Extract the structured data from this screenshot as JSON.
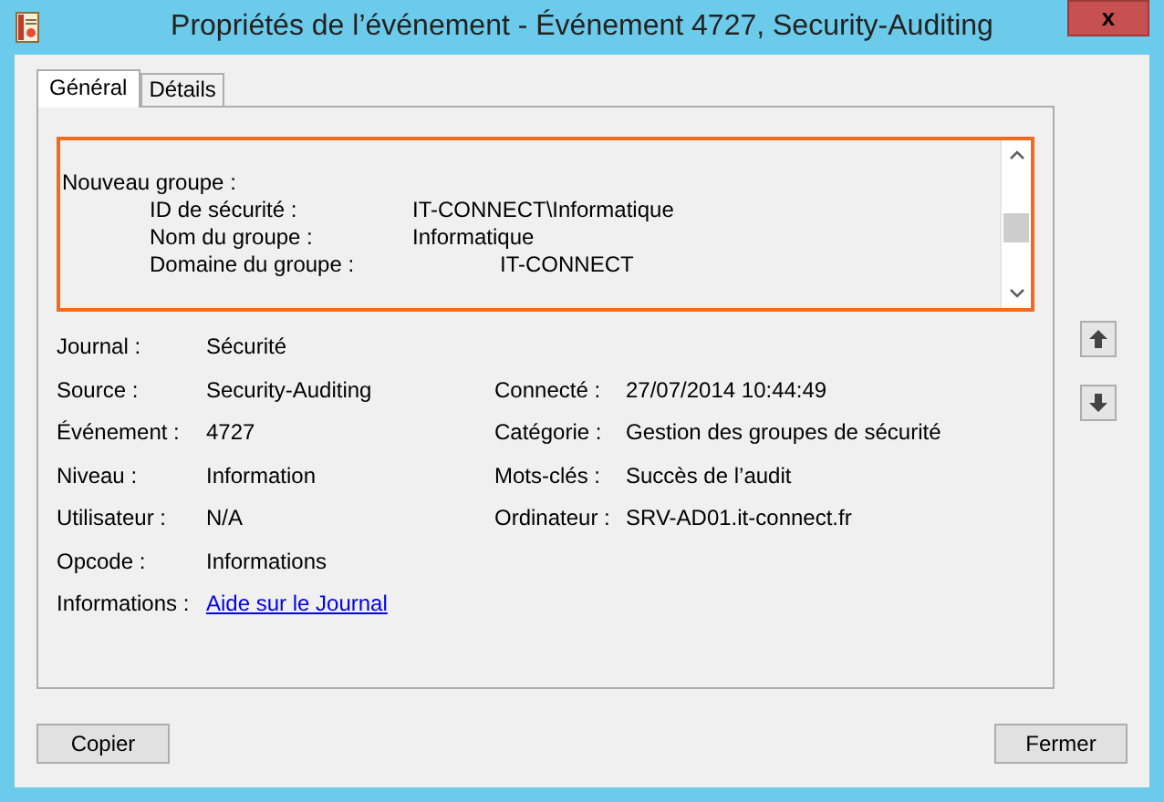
{
  "window": {
    "title": "Propriétés de l’événement - Événement 4727, Security-Auditing",
    "close": "x"
  },
  "tabs": [
    {
      "label": "Général",
      "selected": true
    },
    {
      "label": "Détails",
      "selected": false
    }
  ],
  "description": {
    "lines": [
      {
        "kind": "heading",
        "label": "Nouveau groupe :"
      },
      {
        "kind": "field",
        "label": "ID de sécurité :",
        "value": "IT-CONNECT\\Informatique"
      },
      {
        "kind": "field",
        "label": "Nom du groupe :",
        "value": "Informatique"
      },
      {
        "kind": "fieldtab",
        "label": "Domaine du groupe :",
        "value": "IT-CONNECT"
      }
    ]
  },
  "rows": [
    {
      "left": {
        "label": "Journal :",
        "value": "Sécurité"
      }
    },
    {
      "left": {
        "label": "Source :",
        "value": "Security-Auditing"
      },
      "right": {
        "label": "Connecté :",
        "value": "27/07/2014 10:44:49"
      }
    },
    {
      "left": {
        "label": "Événement :",
        "value": "4727"
      },
      "right": {
        "label": "Catégorie :",
        "value": "Gestion des groupes de sécurité"
      }
    },
    {
      "left": {
        "label": "Niveau :",
        "value": "Information"
      },
      "right": {
        "label": "Mots-clés :",
        "value": "Succès de l’audit"
      }
    },
    {
      "left": {
        "label": "Utilisateur :",
        "value": "N/A"
      },
      "right": {
        "label": "Ordinateur :",
        "value": "SRV-AD01.it-connect.fr"
      }
    },
    {
      "left": {
        "label": "Opcode :",
        "value": "Informations"
      }
    },
    {
      "left": {
        "label": "Informations :",
        "value": "Aide sur le Journal",
        "kind": "link"
      }
    }
  ],
  "buttons": [
    {
      "label": "Copier"
    },
    {
      "label": "Fermer"
    }
  ]
}
